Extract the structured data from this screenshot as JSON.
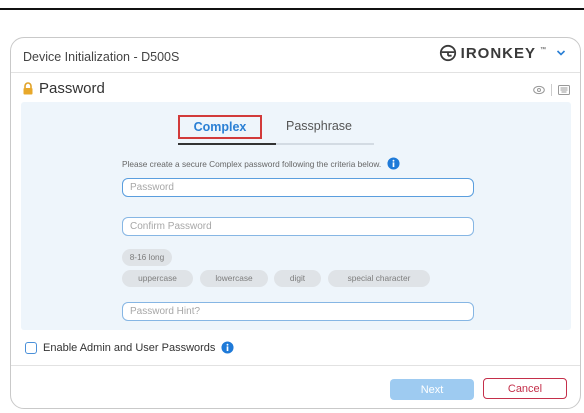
{
  "window": {
    "title": "Device Initialization - D500S",
    "brand": {
      "name": "IRONKEY",
      "tm": "™"
    }
  },
  "section": {
    "title": "Password"
  },
  "tabs": [
    {
      "label": "Complex",
      "active": true
    },
    {
      "label": "Passphrase",
      "active": false
    }
  ],
  "form": {
    "instruction": "Please create a secure Complex password following the criteria below.",
    "password_placeholder": "Password",
    "password_value": "",
    "confirm_placeholder": "Confirm Password",
    "confirm_value": "",
    "hint_placeholder": "Password Hint?",
    "hint_value": ""
  },
  "criteria": {
    "length": "8-16 long",
    "chips": [
      "uppercase",
      "lowercase",
      "digit",
      "special character"
    ]
  },
  "options": {
    "enable_admin_user_label": "Enable Admin and User Passwords",
    "enable_admin_user_checked": false
  },
  "buttons": {
    "next": "Next",
    "cancel": "Cancel"
  },
  "colors": {
    "accent": "#2a7fd4",
    "tab_highlight": "#d23a3a",
    "panel_bg": "#eef5fb",
    "next_bg": "#9ecbf1",
    "cancel": "#c42f4a"
  }
}
